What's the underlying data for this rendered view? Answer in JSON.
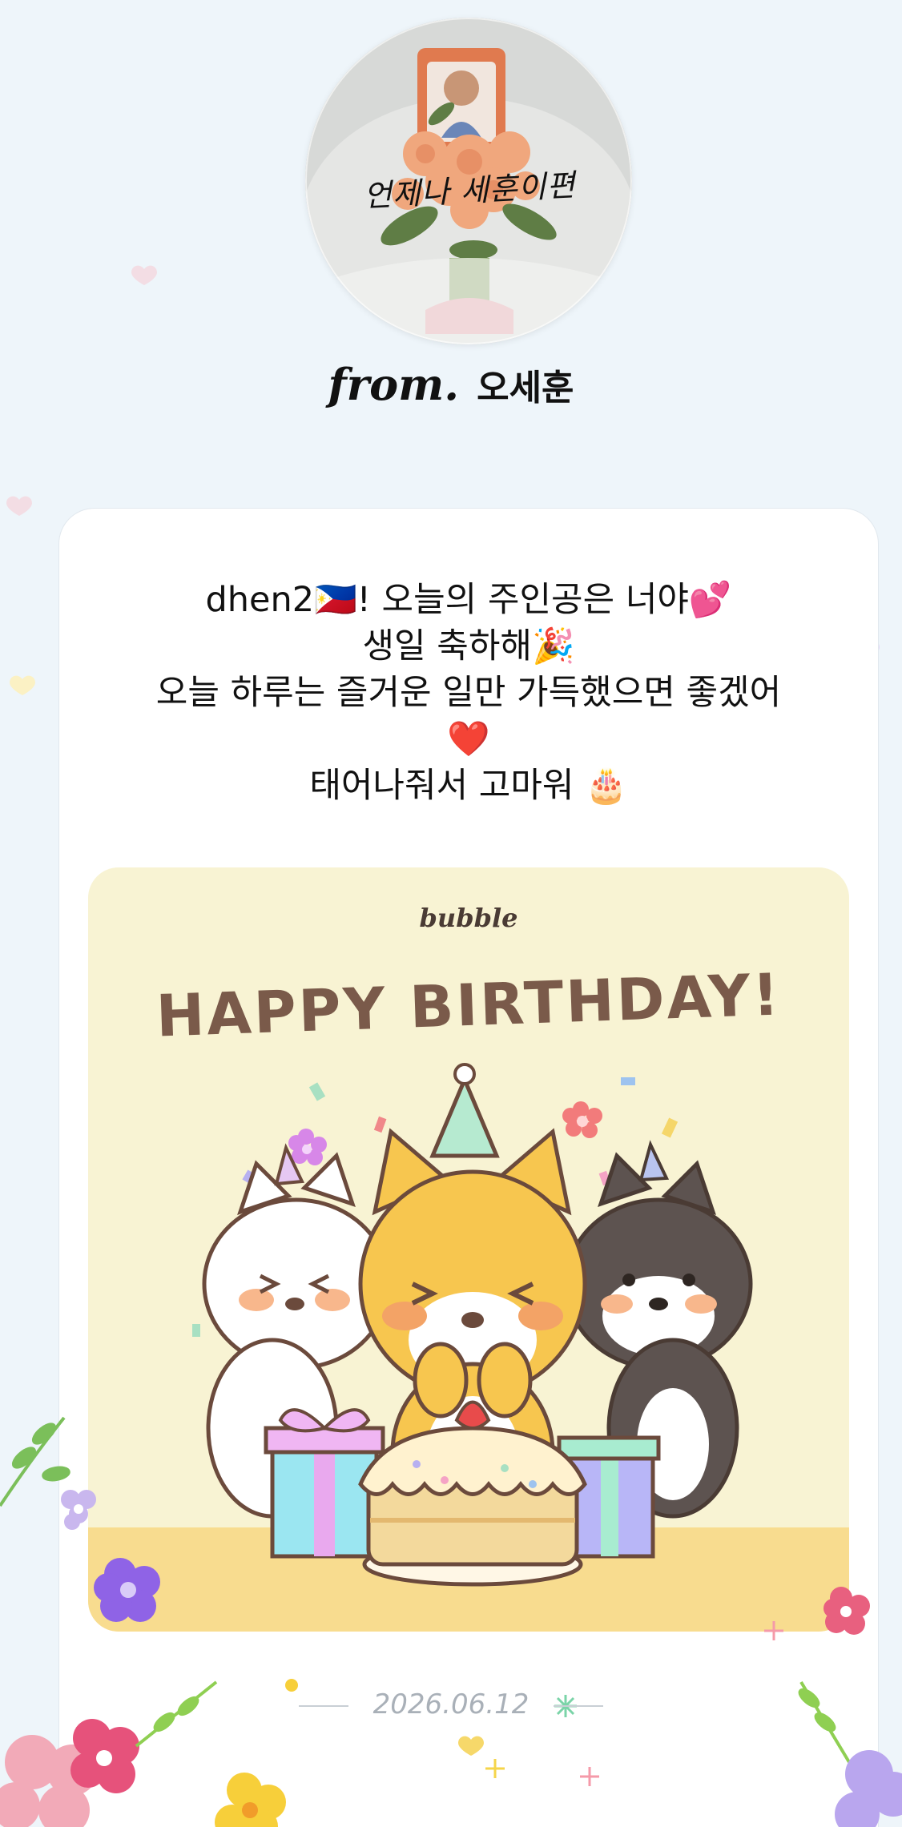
{
  "sender": {
    "avatar_caption": "언제나 세훈이편",
    "from_label": "from.",
    "name": "오세훈"
  },
  "message": {
    "lines": [
      "dhen2🇵🇭! 오늘의 주인공은 너야💕",
      "생일 축하해🎉",
      "오늘 하루는 즐거운 일만 가득했으면 좋겠어",
      "❤️",
      "태어나줘서 고마워 🎂"
    ]
  },
  "birthday_card": {
    "brand": "bubble",
    "title": "HAPPY BIRTHDAY!"
  },
  "footer": {
    "date": "2026.06.12"
  },
  "colors": {
    "background": "#eef5fa",
    "card": "#ffffff",
    "birthday_card_bg": "#f8f3d3",
    "birthday_floor": "#f8dc8f",
    "title_brown": "#7a5a4a",
    "date_gray": "#a9b0b8"
  }
}
